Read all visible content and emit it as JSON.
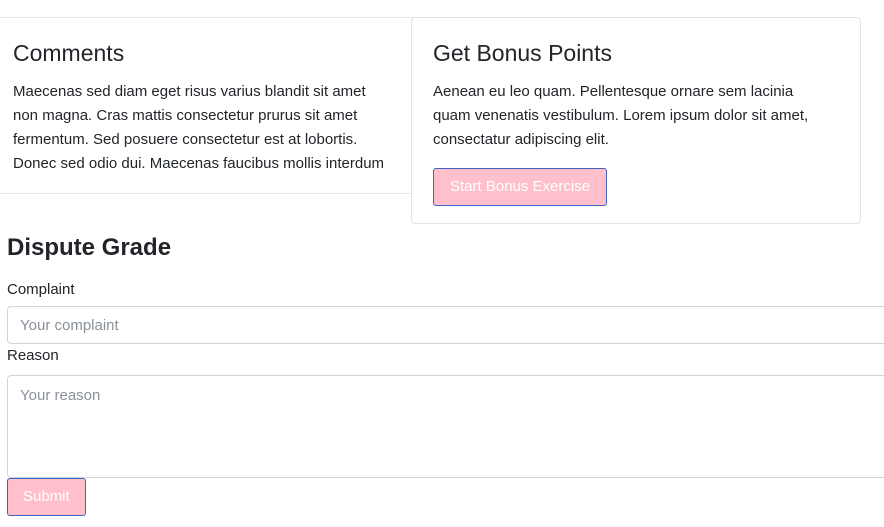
{
  "comments": {
    "title": "Comments",
    "lines": [
      "Maecenas sed diam eget risus varius blandit sit amet",
      "non magna. Cras mattis consectetur prurus sit amet",
      "fermentum. Sed posuere consectetur est at lobortis.",
      "Donec sed odio dui. Maecenas faucibus mollis interdum"
    ]
  },
  "bonus": {
    "title": "Get Bonus Points",
    "lines": [
      "Aenean eu leo quam. Pellentesque ornare sem lacinia",
      "quam venenatis vestibulum. Lorem ipsum dolor sit amet,",
      "consectatur adipiscing elit."
    ],
    "button_label": "Start Bonus Exercise"
  },
  "dispute": {
    "title": "Dispute Grade",
    "complaint_label": "Complaint",
    "complaint_placeholder": "Your complaint",
    "complaint_value": "",
    "reason_label": "Reason",
    "reason_placeholder": "Your reason",
    "reason_value": "",
    "submit_label": "Submit"
  },
  "colors": {
    "button_fill": "#ffc0cb",
    "button_border": "#3d64c2",
    "text": "#212529"
  }
}
